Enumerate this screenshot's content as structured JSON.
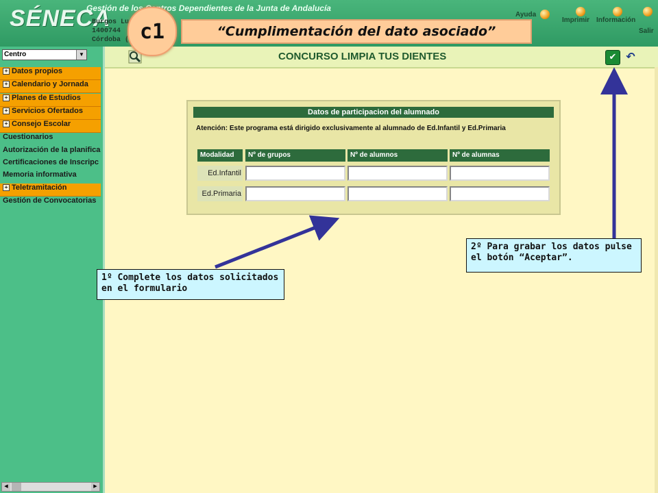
{
  "header": {
    "logo": "SÉNECA",
    "title": "Gestión de los Centros Dependientes de la Junta de Andalucía",
    "center_line1": "Burgos Lu",
    "center_line2": "1400744",
    "center_line3": "Córdoba (C",
    "links": {
      "help": "Ayuda",
      "print": "Imprimir",
      "info": "Información",
      "exit": "Salir"
    }
  },
  "step": {
    "badge": "c1",
    "title": "“Cumplimentación del dato asociado”"
  },
  "sidebar": {
    "select_value": "Centro",
    "items": [
      {
        "label": "Datos propios",
        "expandable": true
      },
      {
        "label": "Calendario y Jornada",
        "expandable": true
      },
      {
        "label": "Planes de Estudios",
        "expandable": true
      },
      {
        "label": "Servicios Ofertados",
        "expandable": true
      },
      {
        "label": "Consejo Escolar",
        "expandable": true
      },
      {
        "label": "Cuestionarios",
        "expandable": false
      },
      {
        "label": "Autorización de la planifica",
        "expandable": false
      },
      {
        "label": "Certificaciones de Inscripc",
        "expandable": false
      },
      {
        "label": "Memoria informativa",
        "expandable": false
      },
      {
        "label": "Teletramitación",
        "expandable": true
      },
      {
        "label": "Gestión de Convocatorias",
        "expandable": false
      }
    ]
  },
  "main": {
    "title": "CONCURSO LIMPIA TUS DIENTES"
  },
  "form": {
    "title": "Datos de participacion del alumnado",
    "note": "Atención: Este programa está dirigido exclusivamente al alumnado de Ed.Infantil y Ed.Primaria",
    "headers": [
      "Modalidad",
      "Nº de grupos",
      "Nº de alumnos",
      "Nº de alumnas"
    ],
    "rows": [
      {
        "label": "Ed.Infantil",
        "values": [
          "",
          "",
          ""
        ]
      },
      {
        "label": "Ed.Primaria",
        "values": [
          "",
          "",
          ""
        ]
      }
    ]
  },
  "callouts": {
    "one": "1º Complete los datos solicitados en el formulario",
    "two": "2º Para grabar los datos pulse el botón “Aceptar”."
  },
  "colors": {
    "header_green": "#3aa86f",
    "sidebar_green": "#4cbf88",
    "menu_orange": "#f5a000",
    "content_bg": "#fff7c4",
    "callout_bg": "#ccf6ff",
    "step_bg": "#ffcc99",
    "arrow": "#333399"
  }
}
